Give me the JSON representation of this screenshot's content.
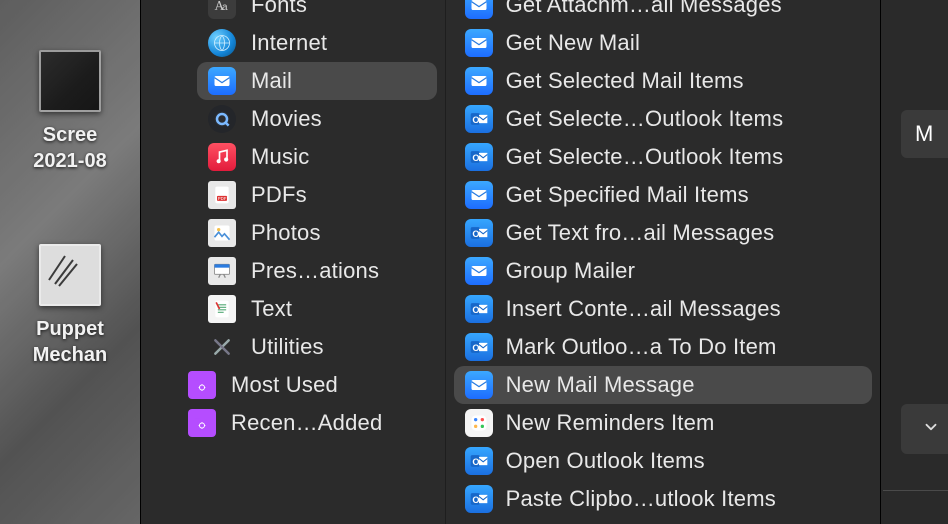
{
  "desktop": {
    "items": [
      {
        "label": "Scree\n2021-08"
      },
      {
        "label": "Puppet\nMechan"
      }
    ]
  },
  "categories": {
    "items": [
      {
        "icon": "fonts",
        "label": "Fonts"
      },
      {
        "icon": "internet",
        "label": "Internet"
      },
      {
        "icon": "mail",
        "label": "Mail",
        "selected": true
      },
      {
        "icon": "movies",
        "label": "Movies"
      },
      {
        "icon": "music",
        "label": "Music"
      },
      {
        "icon": "pdf",
        "label": "PDFs"
      },
      {
        "icon": "photos",
        "label": "Photos"
      },
      {
        "icon": "pres",
        "label": "Pres…ations"
      },
      {
        "icon": "text",
        "label": "Text"
      },
      {
        "icon": "util",
        "label": "Utilities"
      }
    ],
    "special": [
      {
        "icon": "folder",
        "label": "Most Used"
      },
      {
        "icon": "folder",
        "label": "Recen…Added"
      }
    ]
  },
  "actions": {
    "items": [
      {
        "icon": "mail",
        "label": "Get Attachm…ail Messages"
      },
      {
        "icon": "mail",
        "label": "Get New Mail"
      },
      {
        "icon": "mail",
        "label": "Get Selected Mail Items"
      },
      {
        "icon": "outlook",
        "label": "Get Selecte…Outlook Items"
      },
      {
        "icon": "outlook",
        "label": "Get Selecte…Outlook Items"
      },
      {
        "icon": "mail",
        "label": "Get Specified Mail Items"
      },
      {
        "icon": "outlook",
        "label": "Get Text fro…ail Messages"
      },
      {
        "icon": "mail",
        "label": "Group Mailer"
      },
      {
        "icon": "outlook",
        "label": "Insert Conte…ail Messages"
      },
      {
        "icon": "outlook",
        "label": "Mark Outloo…a To Do Item"
      },
      {
        "icon": "mail",
        "label": "New Mail Message",
        "selected": true
      },
      {
        "icon": "reminder",
        "label": "New Reminders Item"
      },
      {
        "icon": "outlook",
        "label": "Open Outlook Items"
      },
      {
        "icon": "outlook",
        "label": "Paste Clipbo…utlook Items"
      }
    ]
  },
  "rightbar": {
    "slab1_letter": "M"
  }
}
